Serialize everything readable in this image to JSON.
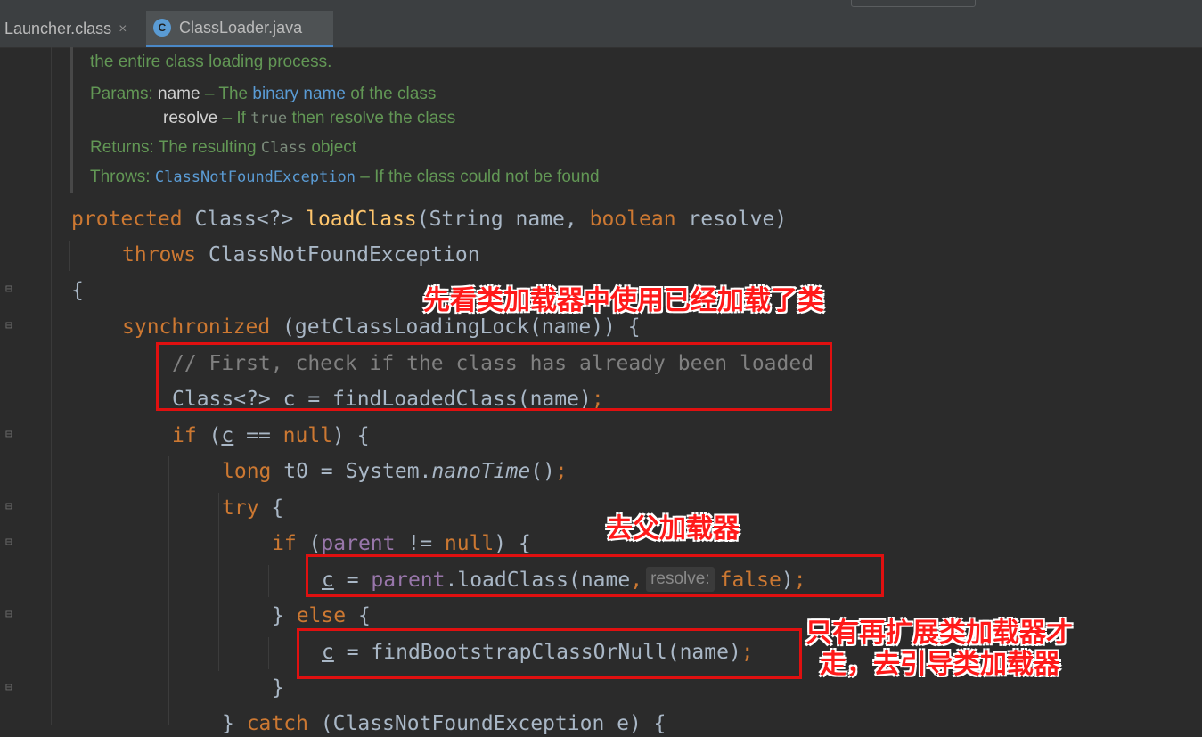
{
  "tabs": [
    {
      "label": "Launcher.class",
      "close": "×"
    },
    {
      "label": "ClassLoader.java",
      "icon_text": "C"
    }
  ],
  "doc": {
    "line0": "the entire class loading process.",
    "params_label": "Params:",
    "p1_name": "name",
    "p1_dash": " – The ",
    "p1_link": "binary name",
    "p1_rest": " of the class",
    "p2_name": "resolve",
    "p2_pre": " – If ",
    "p2_code": "true",
    "p2_rest": " then resolve the class",
    "returns_label": "Returns:",
    "returns_pre": "The resulting ",
    "returns_code": "Class",
    "returns_rest": " object",
    "throws_label": "Throws:",
    "throws_link": "ClassNotFoundException",
    "throws_rest": " – If the class could not be found"
  },
  "code": {
    "l1_kw": "protected",
    "l1_a": " Class<?> ",
    "l1_fn": "loadClass",
    "l1_b": "(String name, ",
    "l1_kw2": "boolean",
    "l1_c": " resolve)",
    "l2_kw": "throws",
    "l2_a": " ClassNotFoundException",
    "l3": "{",
    "l4_kw": "synchronized",
    "l4_a": " (getClassLoadingLock(name)) {",
    "l5_comment": "// First, check if the class has already been loaded",
    "l6_a": "Class<?> c = findLoadedClass(name)",
    "l6_semi": ";",
    "l7_kw": "if",
    "l7_a": " (",
    "l7_c": "c",
    "l7_b": " == ",
    "l7_null": "null",
    "l7_d": ") {",
    "l8_kw": "long",
    "l8_a": " t0 = System.",
    "l8_it": "nanoTime",
    "l8_b": "()",
    "l8_semi": ";",
    "l9_kw": "try",
    "l9_a": " {",
    "l10_kw": "if",
    "l10_a": " (",
    "l10_fld": "parent",
    "l10_b": " != ",
    "l10_null": "null",
    "l10_c": ") {",
    "l11_c": "c",
    "l11_a": " = ",
    "l11_fld": "parent",
    "l11_b": ".loadClass(name",
    "l11_comma": ",",
    "l11_hint": "resolve:",
    "l11_false": "false",
    "l11_end": ")",
    "l11_semi": ";",
    "l12_a": "} ",
    "l12_kw": "else",
    "l12_b": " {",
    "l13_c": "c",
    "l13_a": " = findBootstrapClassOrNull(name)",
    "l13_semi": ";",
    "l14": "}",
    "l15_a": "} ",
    "l15_kw": "catch",
    "l15_b": " (ClassNotFoundException e) {"
  },
  "annotations": {
    "a1": "先看类加载器中使用已经加载了类",
    "a2": "去父加载器",
    "a3_line1": "只有再扩展类加载器才",
    "a3_line2": "走，去引导类加载器"
  },
  "colors": {
    "background": "#2b2b2b",
    "keyword": "#cc7832",
    "function": "#ffc66d",
    "comment": "#808080",
    "doc": "#629755",
    "annotation": "#ff1a1a"
  }
}
